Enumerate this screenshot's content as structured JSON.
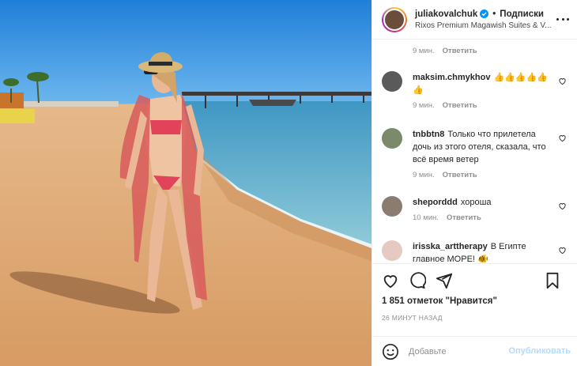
{
  "post": {
    "username": "juliakovalchuk",
    "follow_label": "Подписки",
    "location": "Rixos Premium Magawish Suites & V..."
  },
  "top_meta": {
    "time": "9 мин.",
    "reply": "Ответить"
  },
  "comments": [
    {
      "user": "maksim.chmykhov",
      "text": "👍👍👍👍👍👍",
      "time": "9 мин.",
      "reply": "Ответить"
    },
    {
      "user": "tnbbtn8",
      "text": "Только что прилетела дочь из этого отеля, сказала, что всё время ветер",
      "time": "9 мин.",
      "reply": "Ответить"
    },
    {
      "user": "sheporddd",
      "text": "хороша",
      "time": "10 мин.",
      "reply": "Ответить"
    },
    {
      "user": "irisska_arttherapy",
      "text": "В Египте главное МОРЕ! 🐠",
      "time": "",
      "reply": ""
    }
  ],
  "likes": "1 851 отметок \"Нравится\"",
  "time_ago": "26 МИНУТ НАЗАД",
  "composer": {
    "placeholder": "Добавьте",
    "publish": "Опубликовать"
  },
  "icons": {
    "more": "more-horizontal-icon",
    "verified": "verified-badge-icon",
    "heart": "heart-icon",
    "comment": "comment-icon",
    "share": "share-icon",
    "bookmark": "bookmark-icon",
    "emoji": "emoji-icon"
  },
  "colors": {
    "accent": "#0095f6",
    "publish_disabled": "#b3dbff",
    "muted": "#8e8e8e"
  }
}
